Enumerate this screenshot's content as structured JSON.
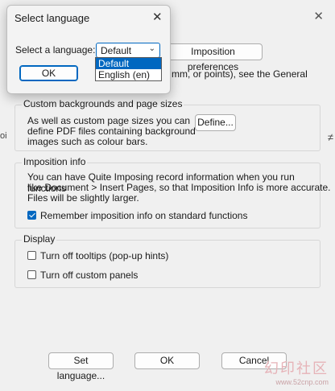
{
  "background": {
    "imposition_prefs_label": "Imposition preferences",
    "units_fragment": "mm, or points), see the General",
    "left_edge_fragment": "oi",
    "right_edge_fragment": "≠",
    "custom_backgrounds": {
      "title": "Custom backgrounds and page sizes",
      "text_line1": "As well as custom page sizes you can",
      "text_line2": "define PDF files containing background",
      "text_line3": "images such as colour bars.",
      "define_label": "Define..."
    },
    "imposition_info": {
      "title": "Imposition info",
      "text_line1": "You can have Quite Imposing record information when you run functions",
      "text_line2": "like Document > Insert Pages, so that Imposition Info is more accurate.",
      "text_line3": "Files will be slightly larger.",
      "remember_label": "Remember imposition info on standard functions",
      "remember_checked": true
    },
    "display": {
      "title": "Display",
      "tooltips_label": "Turn off tooltips (pop-up hints)",
      "tooltips_checked": false,
      "panels_label": "Turn off custom panels",
      "panels_checked": false
    },
    "footer": {
      "set_language_label": "Set language...",
      "ok_label": "OK",
      "cancel_label": "Cancel"
    }
  },
  "dialog": {
    "title": "Select language",
    "prompt": "Select a language:",
    "selected": "Default",
    "options": [
      "Default",
      "English (en)"
    ],
    "ok_label": "OK"
  },
  "watermark": {
    "text": "幻印社区",
    "url": "www.52cnp.com"
  },
  "colors": {
    "accent": "#0067c0"
  }
}
